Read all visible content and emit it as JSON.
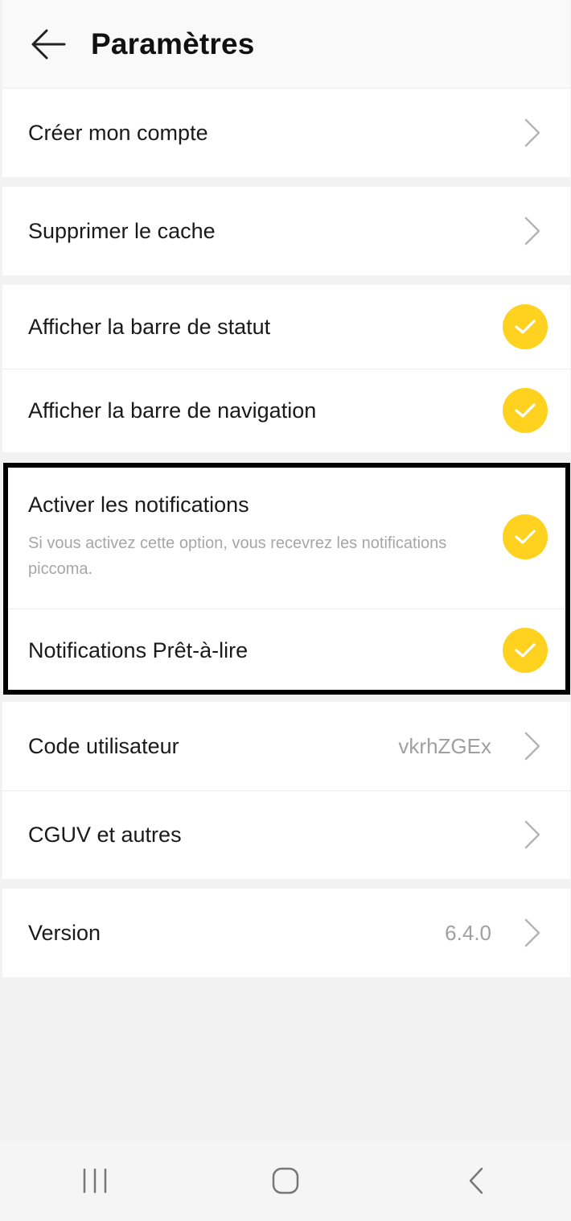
{
  "header": {
    "title": "Paramètres",
    "back_icon": "arrow-left-icon"
  },
  "settings": {
    "create_account": {
      "label": "Créer mon compte"
    },
    "clear_cache": {
      "label": "Supprimer le cache"
    },
    "show_status_bar": {
      "label": "Afficher la barre de statut",
      "checked": true
    },
    "show_nav_bar": {
      "label": "Afficher la barre de navigation",
      "checked": true
    },
    "enable_notifications": {
      "label": "Activer les notifications",
      "description": "Si vous activez cette option, vous recevrez les notifications piccoma.",
      "checked": true
    },
    "ready_to_read": {
      "label": "Notifications Prêt-à-lire",
      "checked": true
    },
    "user_code": {
      "label": "Code utilisateur",
      "value": "vkrhZGEx"
    },
    "terms": {
      "label": "CGUV et autres"
    },
    "version": {
      "label": "Version",
      "value": "6.4.0"
    }
  },
  "colors": {
    "accent": "#ffd21f",
    "background": "#f2f2f2",
    "row": "#ffffff",
    "secondary_text": "#a0a0a0"
  },
  "system_nav": {
    "recents_icon": "recent-apps-icon",
    "home_icon": "home-icon",
    "back_icon": "system-back-icon"
  }
}
